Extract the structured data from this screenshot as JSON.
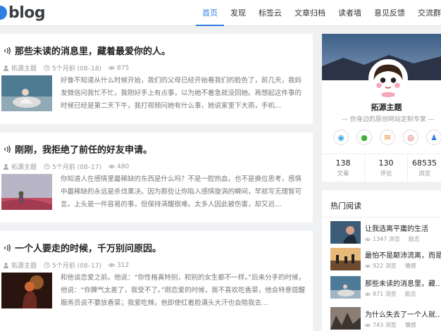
{
  "header": {
    "logo_text": "blog",
    "nav": [
      "首页",
      "发现",
      "标签云",
      "文章归档",
      "读者墙",
      "意见反馈",
      "交流群"
    ],
    "active": 0
  },
  "articles": [
    {
      "title": "那些未读的消息里，藏着最爱你的人。",
      "author": "拓源主题",
      "time": "5个月前 (08–18)",
      "views": "875",
      "excerpt": "好像不知道从什么时候开始，我们的父母已经开始看我们的脸色了，前几天，我妈发微信问我忙不忙，我刚好手上有点事，以为她不着急就没回她。再想起这件事的时候已经是第二天下午，我打视频问她有什么事，她说家里下大雨，手机…"
    },
    {
      "title": "刚刚，我拒绝了前任的好友申请。",
      "author": "拓源主题",
      "time": "5个月前 (08–17)",
      "views": "480",
      "excerpt": "你知道人在感情里最稀缺的东西是什么吗？不是一腔热血，也不是换位思考，感情中最稀缺的永远是杀伐果决。因为那些让你陷入感情旋涡的瞬间，早就写无理暂可言。上头是一件容易的事，但保持清醒很难。太多人因此被伤害，却又迟…"
    },
    {
      "title": "一个人要走的时候，千万别问原因。",
      "author": "拓源主题",
      "time": "5个月前 (08–17)",
      "views": "312",
      "excerpt": "和他谈恋爱之前。他说：“你性格真特别，和别的女生都不一样。”后来分手的时候，他说：“你脾气太差了，我受不了。”刚恋爱的时候，我不喜欢吃香菜，他会特意提醒服务员说不要放香菜；我爱吃辣，他即使红着脸满头大汗也会陪我去…"
    }
  ],
  "profile": {
    "name": "拓源主题",
    "tagline": "— 你身边的原创网站定制专家 —",
    "stats": [
      {
        "num": "138",
        "label": "文章"
      },
      {
        "num": "130",
        "label": "评论"
      },
      {
        "num": "68535",
        "label": "浏览"
      }
    ]
  },
  "popular": {
    "title": "热门阅读",
    "items": [
      {
        "title": "让我选离平庸的生活",
        "views": "1347 浏览",
        "extra": "励志"
      },
      {
        "title": "最怕不是颠沛流离，而是…",
        "views": "922 浏览",
        "extra": "情感"
      },
      {
        "title": "那些未读的消息里，藏…",
        "views": "871 浏览",
        "extra": "励志"
      },
      {
        "title": "为什么失去了一个人就…",
        "views": "743 浏览",
        "extra": "情感"
      }
    ]
  },
  "colors": {
    "accent": "#2f7fe0",
    "qq": "#2fa6e4",
    "wechat": "#3ab034",
    "mail": "#e77a1e",
    "weibo": "#e03b3b",
    "user": "#2f7fe0"
  }
}
